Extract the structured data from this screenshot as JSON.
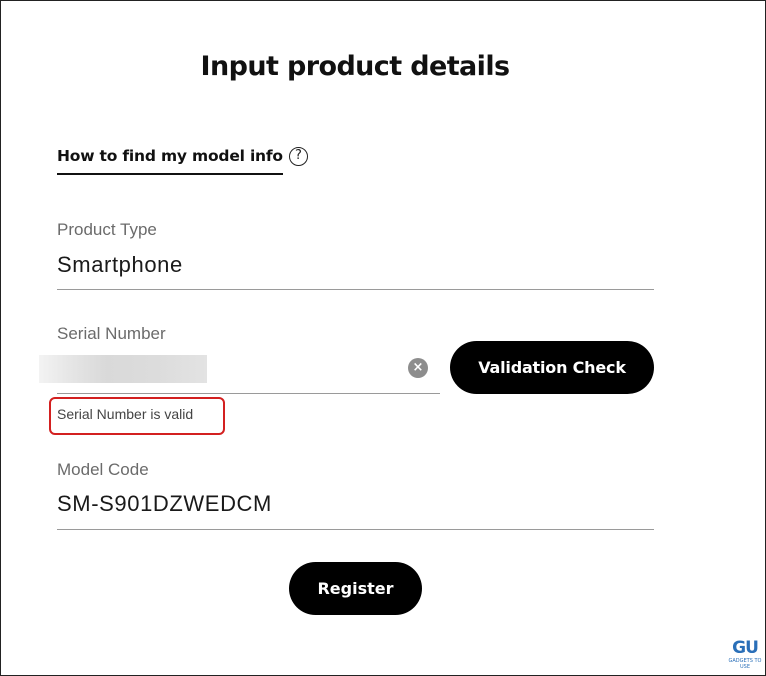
{
  "page": {
    "title": "Input product details",
    "help_link": "How to find my model info",
    "help_icon": "?"
  },
  "product_type": {
    "label": "Product Type",
    "value": "Smartphone"
  },
  "serial_number": {
    "label": "Serial Number",
    "value": "",
    "clear_icon": "×",
    "validate_button": "Validation Check",
    "validation_message": "Serial Number is valid",
    "highlight_color": "#d32020"
  },
  "model_code": {
    "label": "Model Code",
    "value": "SM-S901DZWEDCM"
  },
  "actions": {
    "register_button": "Register"
  },
  "watermark": {
    "letters": "GU",
    "tag": "GADGETS TO USE",
    "color": "#2a6fb8"
  }
}
